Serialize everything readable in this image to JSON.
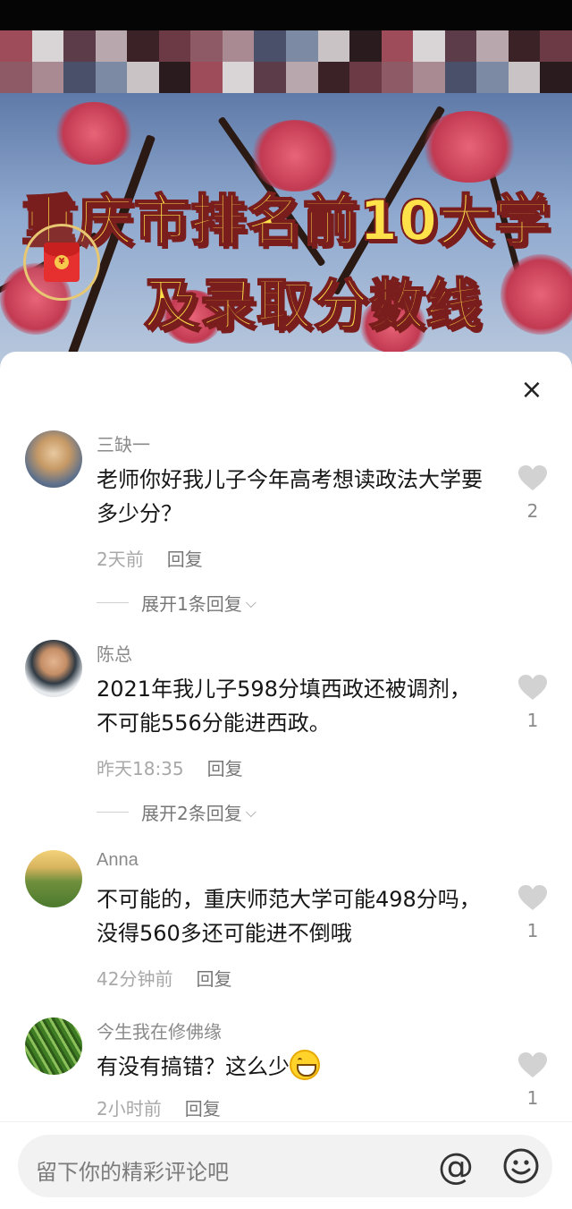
{
  "video": {
    "title_line1": "重庆市排名前10大学",
    "title_line2": "及录取分数线",
    "redpacket_icon": "red-envelope-icon"
  },
  "sheet": {
    "close_label": "×",
    "comments": [
      {
        "username": "三缺一",
        "text": "老师你好我儿子今年高考想读政法大学要多少分？",
        "time": "2天前",
        "reply_label": "回复",
        "likes": "2",
        "expand_label": "展开1条回复"
      },
      {
        "username": "陈总",
        "text": "2021年我儿子598分填西政还被调剂，不可能556分能进西政。",
        "time": "昨天18:35",
        "reply_label": "回复",
        "likes": "1",
        "expand_label": "展开2条回复"
      },
      {
        "username": "Anna",
        "text": "不可能的，重庆师范大学可能498分吗，没得560多还可能进不倒哦",
        "time": "42分钟前",
        "reply_label": "回复",
        "likes": "1"
      },
      {
        "username": "今生我在修佛缘",
        "text": "有没有搞错？这么少",
        "time": "2小时前",
        "reply_label": "回复",
        "likes": "1"
      }
    ]
  },
  "input": {
    "placeholder": "留下你的精彩评论吧",
    "at_label": "@"
  },
  "colors": {
    "title_yellow": "#ffe24a",
    "title_outline": "#7a1d1d",
    "meta_gray": "#a8a8a8",
    "like_gray": "#d2d2d2"
  }
}
